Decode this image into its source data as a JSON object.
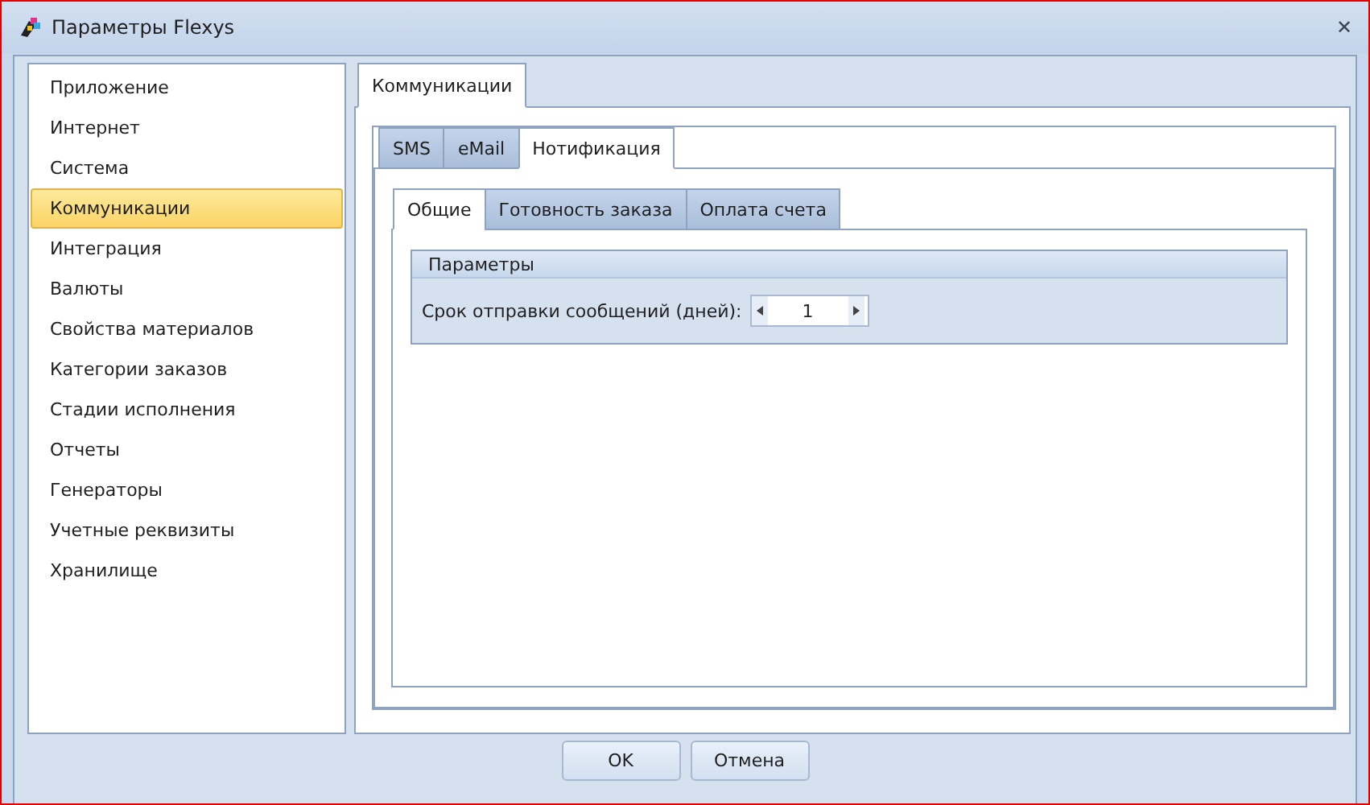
{
  "window": {
    "title": "Параметры Flexys",
    "close": "✕"
  },
  "sidebar": {
    "items": [
      {
        "label": "Приложение",
        "selected": false
      },
      {
        "label": "Интернет",
        "selected": false
      },
      {
        "label": "Система",
        "selected": false
      },
      {
        "label": "Коммуникации",
        "selected": true
      },
      {
        "label": "Интеграция",
        "selected": false
      },
      {
        "label": "Валюты",
        "selected": false
      },
      {
        "label": "Свойства материалов",
        "selected": false
      },
      {
        "label": "Категории заказов",
        "selected": false
      },
      {
        "label": "Стадии исполнения",
        "selected": false
      },
      {
        "label": "Отчеты",
        "selected": false
      },
      {
        "label": "Генераторы",
        "selected": false
      },
      {
        "label": "Учетные реквизиты",
        "selected": false
      },
      {
        "label": "Хранилище",
        "selected": false
      }
    ]
  },
  "page_tabs": [
    {
      "label": "Коммуникации",
      "selected": true
    }
  ],
  "channel_tabs": [
    {
      "label": "SMS",
      "selected": false
    },
    {
      "label": "eMail",
      "selected": false
    },
    {
      "label": "Нотификация",
      "selected": true
    }
  ],
  "sub_tabs": [
    {
      "label": "Общие",
      "selected": true
    },
    {
      "label": "Готовность заказа",
      "selected": false
    },
    {
      "label": "Оплата счета",
      "selected": false
    }
  ],
  "group": {
    "title": "Параметры",
    "field_label": "Срок отправки сообщений (дней):",
    "value": "1"
  },
  "buttons": [
    "OK",
    "Отмена"
  ]
}
